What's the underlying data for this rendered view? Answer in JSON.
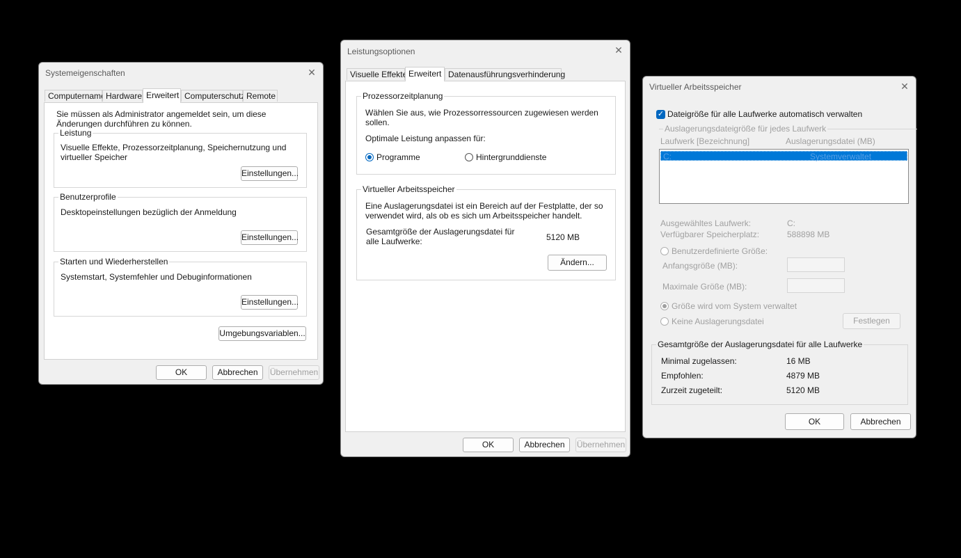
{
  "sys": {
    "title": "Systemeigenschaften",
    "tabs": [
      "Computername",
      "Hardware",
      "Erweitert",
      "Computerschutz",
      "Remote"
    ],
    "admin_note": "Sie müssen als Administrator angemeldet sein, um diese Änderungen durchführen zu können.",
    "perf": {
      "legend": "Leistung",
      "desc": "Visuelle Effekte, Prozessorzeitplanung, Speichernutzung und virtueller Speicher",
      "button": "Einstellungen..."
    },
    "profiles": {
      "legend": "Benutzerprofile",
      "desc": "Desktopeinstellungen bezüglich der Anmeldung",
      "button": "Einstellungen..."
    },
    "startup": {
      "legend": "Starten und Wiederherstellen",
      "desc": "Systemstart, Systemfehler und Debuginformationen",
      "button": "Einstellungen..."
    },
    "env_button": "Umgebungsvariablen...",
    "ok": "OK",
    "cancel": "Abbrechen",
    "apply": "Übernehmen"
  },
  "perfopt": {
    "title": "Leistungsoptionen",
    "tabs": [
      "Visuelle Effekte",
      "Erweitert",
      "Datenausführungsverhinderung"
    ],
    "sched": {
      "legend": "Prozessorzeitplanung",
      "desc": "Wählen Sie aus, wie Prozessorressourcen zugewiesen werden sollen.",
      "optimize": "Optimale Leistung anpassen für:",
      "opt1": "Programme",
      "opt2": "Hintergrunddienste"
    },
    "vm": {
      "legend": "Virtueller Arbeitsspeicher",
      "desc": "Eine Auslagerungsdatei ist ein Bereich auf der Festplatte, der so verwendet wird, als ob es sich um Arbeitsspeicher handelt.",
      "total_label": "Gesamtgröße der Auslagerungsdatei für alle Laufwerke:",
      "total_value": "5120 MB",
      "change_button": "Ändern..."
    },
    "ok": "OK",
    "cancel": "Abbrechen",
    "apply": "Übernehmen"
  },
  "vmem": {
    "title": "Virtueller Arbeitsspeicher",
    "auto_label": "Dateigröße für alle Laufwerke automatisch verwalten",
    "per_drive_legend": "Auslagerungsdateigröße für jedes Laufwerk",
    "col_drive": "Laufwerk [Bezeichnung]",
    "col_pagefile": "Auslagerungsdatei (MB)",
    "rows": [
      {
        "drive": "C:",
        "pagefile": "Systemverwaltet"
      }
    ],
    "sel_drive_label": "Ausgewähltes Laufwerk:",
    "sel_drive_value": "C:",
    "avail_label": "Verfügbarer Speicherplatz:",
    "avail_value": "588898 MB",
    "custom_label": "Benutzerdefinierte Größe:",
    "initial_label": "Anfangsgröße (MB):",
    "max_label": "Maximale Größe (MB):",
    "system_managed_label": "Größe wird vom System verwaltet",
    "no_pagefile_label": "Keine Auslagerungsdatei",
    "set_button": "Festlegen",
    "totals_legend": "Gesamtgröße der Auslagerungsdatei für alle Laufwerke",
    "min_label": "Minimal zugelassen:",
    "min_value": "16 MB",
    "rec_label": "Empfohlen:",
    "rec_value": "4879 MB",
    "cur_label": "Zurzeit zugeteilt:",
    "cur_value": "5120 MB",
    "ok": "OK",
    "cancel": "Abbrechen"
  }
}
